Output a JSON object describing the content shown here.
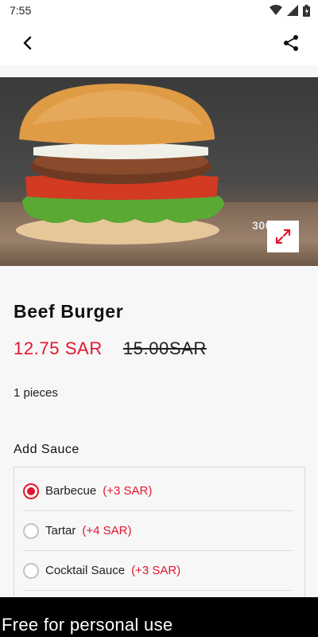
{
  "status_bar": {
    "time": "7:55"
  },
  "product": {
    "name": "Beef Burger",
    "price_current": "12.75 SAR",
    "price_original": "15.00SAR",
    "pieces": "1 pieces",
    "image_weight_text": "300 "
  },
  "sauce_section": {
    "title": "Add Sauce",
    "options": [
      {
        "label": "Barbecue",
        "extra": "(+3 SAR)",
        "selected": true
      },
      {
        "label": "Tartar",
        "extra": "(+4 SAR)",
        "selected": false
      },
      {
        "label": "Cocktail Sauce",
        "extra": "(+3 SAR)",
        "selected": false
      }
    ]
  },
  "watermark": "Free for personal use",
  "colors": {
    "accent": "#e3152e"
  },
  "icons": [
    "back-arrow-icon",
    "share-icon",
    "expand-icon",
    "wifi-icon",
    "cell-signal-icon",
    "battery-icon"
  ]
}
